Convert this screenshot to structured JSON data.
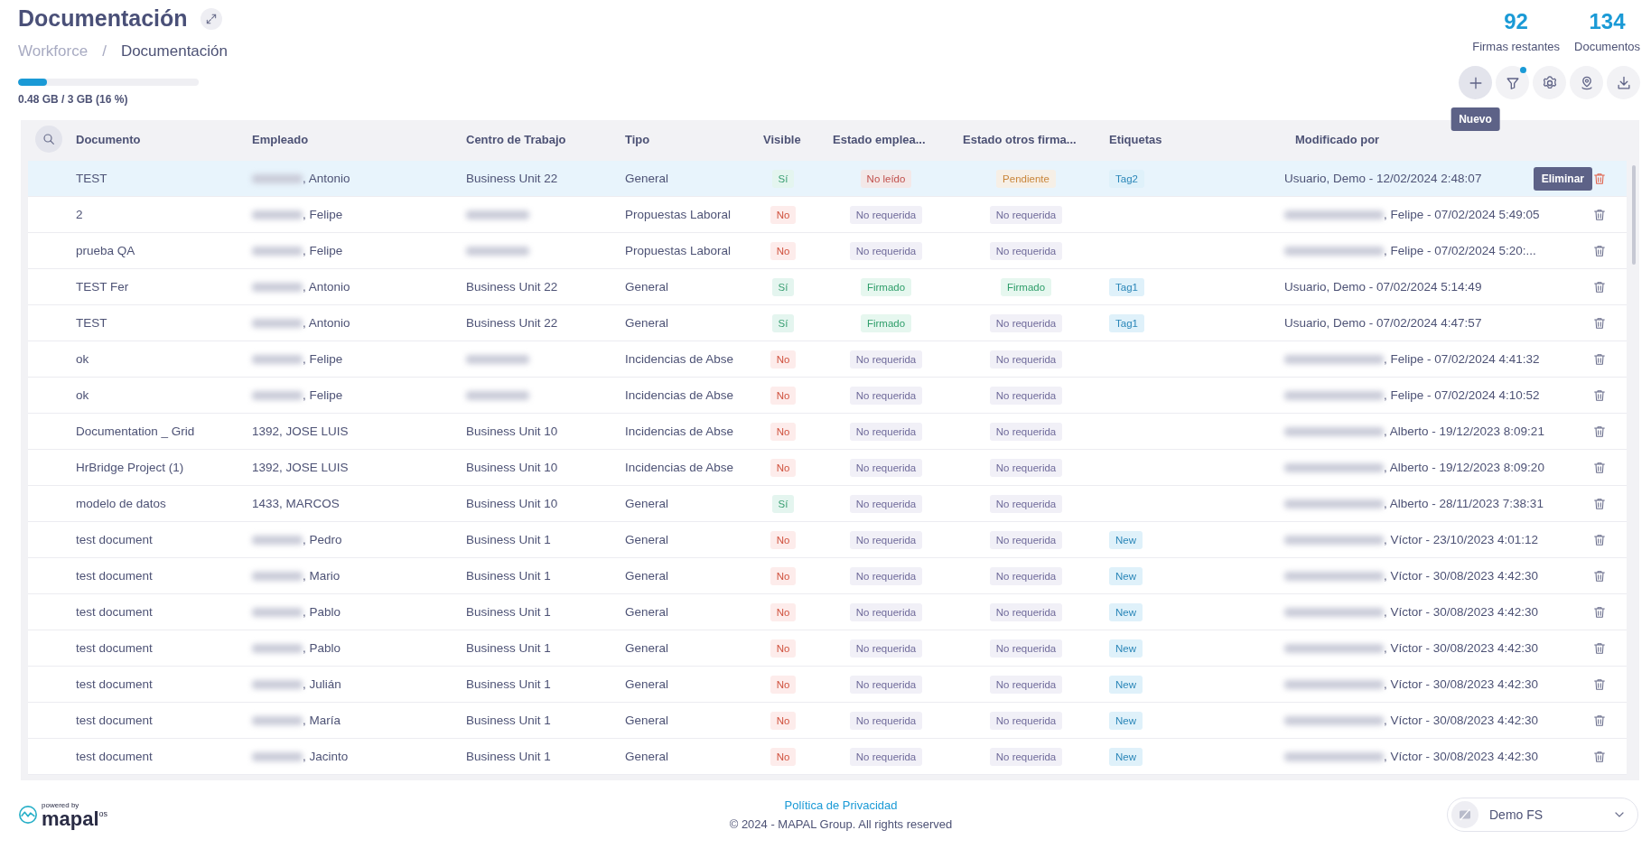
{
  "header": {
    "title": "Documentación",
    "breadcrumb_separator": "/",
    "breadcrumb": [
      {
        "label": "Workforce",
        "current": false
      },
      {
        "label": "Documentación",
        "current": true
      }
    ],
    "storage": {
      "level": 0.16,
      "label": "0.48 GB / 3 GB (16 %)"
    },
    "stats": [
      {
        "value": "92",
        "label": "Firmas restantes"
      },
      {
        "value": "134",
        "label": "Documentos"
      }
    ],
    "toolbar": [
      {
        "kind": "add",
        "active": true,
        "badge": false,
        "tooltip": "Nuevo"
      },
      {
        "kind": "filter",
        "active": false,
        "badge": true
      },
      {
        "kind": "settings",
        "active": false,
        "badge": false
      },
      {
        "kind": "location",
        "active": false,
        "badge": false
      },
      {
        "kind": "download",
        "active": false,
        "badge": false
      }
    ]
  },
  "table": {
    "columns": [
      "Documento",
      "Empleado",
      "Centro de Trabajo",
      "Tipo",
      "Visible",
      "Estado emplea...",
      "Estado otros firma...",
      "Etiquetas",
      "Modificado por"
    ],
    "rows": [
      {
        "document": "TEST",
        "employee": {
          "text": ", Antonio",
          "redacted": true
        },
        "center": {
          "text": "Business Unit 22",
          "redacted": false
        },
        "type": "General",
        "visible": {
          "label": "Sí",
          "on": true
        },
        "employee_status": {
          "label": "No leído",
          "kind": "unread"
        },
        "others_status": {
          "label": "Pendiente",
          "kind": "pending"
        },
        "tags": [
          "Tag2"
        ],
        "modified": {
          "text": "Usuario, Demo - 12/02/2024 2:48:07",
          "redacted": false
        },
        "hovered": true,
        "delete_tooltip": "Eliminar"
      },
      {
        "document": "2",
        "employee": {
          "text": ", Felipe",
          "redacted": true
        },
        "center": {
          "redacted": true
        },
        "type": "Propuestas Laboral",
        "visible": {
          "label": "No",
          "on": false
        },
        "employee_status": {
          "label": "No requerida",
          "kind": "not_required"
        },
        "others_status": {
          "label": "No requerida",
          "kind": "not_required"
        },
        "tags": [],
        "modified": {
          "text": ", Felipe - 07/02/2024 5:49:05",
          "redacted": true
        },
        "hovered": false
      },
      {
        "document": "prueba QA",
        "employee": {
          "text": ", Felipe",
          "redacted": true
        },
        "center": {
          "redacted": true
        },
        "type": "Propuestas Laboral",
        "visible": {
          "label": "No",
          "on": false
        },
        "employee_status": {
          "label": "No requerida",
          "kind": "not_required"
        },
        "others_status": {
          "label": "No requerida",
          "kind": "not_required"
        },
        "tags": [],
        "modified": {
          "text": ", Felipe - 07/02/2024 5:20:...",
          "redacted": true
        },
        "hovered": false
      },
      {
        "document": "TEST Fer",
        "employee": {
          "text": ", Antonio",
          "redacted": true
        },
        "center": {
          "text": "Business Unit 22",
          "redacted": false
        },
        "type": "General",
        "visible": {
          "label": "Sí",
          "on": true
        },
        "employee_status": {
          "label": "Firmado",
          "kind": "signed"
        },
        "others_status": {
          "label": "Firmado",
          "kind": "signed"
        },
        "tags": [
          "Tag1"
        ],
        "modified": {
          "text": "Usuario, Demo - 07/02/2024 5:14:49",
          "redacted": false
        },
        "hovered": false
      },
      {
        "document": "TEST",
        "employee": {
          "text": ", Antonio",
          "redacted": true
        },
        "center": {
          "text": "Business Unit 22",
          "redacted": false
        },
        "type": "General",
        "visible": {
          "label": "Sí",
          "on": true
        },
        "employee_status": {
          "label": "Firmado",
          "kind": "signed"
        },
        "others_status": {
          "label": "No requerida",
          "kind": "not_required"
        },
        "tags": [
          "Tag1"
        ],
        "modified": {
          "text": "Usuario, Demo - 07/02/2024 4:47:57",
          "redacted": false
        },
        "hovered": false
      },
      {
        "document": "ok",
        "employee": {
          "text": ", Felipe",
          "redacted": true
        },
        "center": {
          "redacted": true
        },
        "type": "Incidencias de Abse",
        "visible": {
          "label": "No",
          "on": false
        },
        "employee_status": {
          "label": "No requerida",
          "kind": "not_required"
        },
        "others_status": {
          "label": "No requerida",
          "kind": "not_required"
        },
        "tags": [],
        "modified": {
          "text": ", Felipe - 07/02/2024 4:41:32",
          "redacted": true
        },
        "hovered": false
      },
      {
        "document": "ok",
        "employee": {
          "text": ", Felipe",
          "redacted": true
        },
        "center": {
          "redacted": true
        },
        "type": "Incidencias de Abse",
        "visible": {
          "label": "No",
          "on": false
        },
        "employee_status": {
          "label": "No requerida",
          "kind": "not_required"
        },
        "others_status": {
          "label": "No requerida",
          "kind": "not_required"
        },
        "tags": [],
        "modified": {
          "text": ", Felipe - 07/02/2024 4:10:52",
          "redacted": true
        },
        "hovered": false
      },
      {
        "document": "Documentation _ Grid",
        "employee": {
          "text": "1392, JOSE LUIS",
          "redacted": false
        },
        "center": {
          "text": "Business Unit 10",
          "redacted": false
        },
        "type": "Incidencias de Abse",
        "visible": {
          "label": "No",
          "on": false
        },
        "employee_status": {
          "label": "No requerida",
          "kind": "not_required"
        },
        "others_status": {
          "label": "No requerida",
          "kind": "not_required"
        },
        "tags": [],
        "modified": {
          "text": ", Alberto - 19/12/2023 8:09:21",
          "redacted": true
        },
        "hovered": false
      },
      {
        "document": "HrBridge Project (1)",
        "employee": {
          "text": "1392, JOSE LUIS",
          "redacted": false
        },
        "center": {
          "text": "Business Unit 10",
          "redacted": false
        },
        "type": "Incidencias de Abse",
        "visible": {
          "label": "No",
          "on": false
        },
        "employee_status": {
          "label": "No requerida",
          "kind": "not_required"
        },
        "others_status": {
          "label": "No requerida",
          "kind": "not_required"
        },
        "tags": [],
        "modified": {
          "text": ", Alberto - 19/12/2023 8:09:20",
          "redacted": true
        },
        "hovered": false
      },
      {
        "document": "modelo de datos",
        "employee": {
          "text": "1433, MARCOS",
          "redacted": false
        },
        "center": {
          "text": "Business Unit 10",
          "redacted": false
        },
        "type": "General",
        "visible": {
          "label": "Sí",
          "on": true
        },
        "employee_status": {
          "label": "No requerida",
          "kind": "not_required"
        },
        "others_status": {
          "label": "No requerida",
          "kind": "not_required"
        },
        "tags": [],
        "modified": {
          "text": ", Alberto - 28/11/2023 7:38:31",
          "redacted": true
        },
        "hovered": false
      },
      {
        "document": "test document",
        "employee": {
          "text": ", Pedro",
          "redacted": true
        },
        "center": {
          "text": "Business Unit 1",
          "redacted": false
        },
        "type": "General",
        "visible": {
          "label": "No",
          "on": false
        },
        "employee_status": {
          "label": "No requerida",
          "kind": "not_required"
        },
        "others_status": {
          "label": "No requerida",
          "kind": "not_required"
        },
        "tags": [
          "New"
        ],
        "modified": {
          "text": ", Víctor - 23/10/2023 4:01:12",
          "redacted": true
        },
        "hovered": false
      },
      {
        "document": "test document",
        "employee": {
          "text": ", Mario",
          "redacted": true
        },
        "center": {
          "text": "Business Unit 1",
          "redacted": false
        },
        "type": "General",
        "visible": {
          "label": "No",
          "on": false
        },
        "employee_status": {
          "label": "No requerida",
          "kind": "not_required"
        },
        "others_status": {
          "label": "No requerida",
          "kind": "not_required"
        },
        "tags": [
          "New"
        ],
        "modified": {
          "text": ", Víctor - 30/08/2023 4:42:30",
          "redacted": true
        },
        "hovered": false
      },
      {
        "document": "test document",
        "employee": {
          "text": ", Pablo",
          "redacted": true
        },
        "center": {
          "text": "Business Unit 1",
          "redacted": false
        },
        "type": "General",
        "visible": {
          "label": "No",
          "on": false
        },
        "employee_status": {
          "label": "No requerida",
          "kind": "not_required"
        },
        "others_status": {
          "label": "No requerida",
          "kind": "not_required"
        },
        "tags": [
          "New"
        ],
        "modified": {
          "text": ", Víctor - 30/08/2023 4:42:30",
          "redacted": true
        },
        "hovered": false
      },
      {
        "document": "test document",
        "employee": {
          "text": ", Pablo",
          "redacted": true
        },
        "center": {
          "text": "Business Unit 1",
          "redacted": false
        },
        "type": "General",
        "visible": {
          "label": "No",
          "on": false
        },
        "employee_status": {
          "label": "No requerida",
          "kind": "not_required"
        },
        "others_status": {
          "label": "No requerida",
          "kind": "not_required"
        },
        "tags": [
          "New"
        ],
        "modified": {
          "text": ", Víctor - 30/08/2023 4:42:30",
          "redacted": true
        },
        "hovered": false
      },
      {
        "document": "test document",
        "employee": {
          "text": ", Julián",
          "redacted": true
        },
        "center": {
          "text": "Business Unit 1",
          "redacted": false
        },
        "type": "General",
        "visible": {
          "label": "No",
          "on": false
        },
        "employee_status": {
          "label": "No requerida",
          "kind": "not_required"
        },
        "others_status": {
          "label": "No requerida",
          "kind": "not_required"
        },
        "tags": [
          "New"
        ],
        "modified": {
          "text": ", Víctor - 30/08/2023 4:42:30",
          "redacted": true
        },
        "hovered": false
      },
      {
        "document": "test document",
        "employee": {
          "text": ", María",
          "redacted": true
        },
        "center": {
          "text": "Business Unit 1",
          "redacted": false
        },
        "type": "General",
        "visible": {
          "label": "No",
          "on": false
        },
        "employee_status": {
          "label": "No requerida",
          "kind": "not_required"
        },
        "others_status": {
          "label": "No requerida",
          "kind": "not_required"
        },
        "tags": [
          "New"
        ],
        "modified": {
          "text": ", Víctor - 30/08/2023 4:42:30",
          "redacted": true
        },
        "hovered": false
      },
      {
        "document": "test document",
        "employee": {
          "text": ", Jacinto",
          "redacted": true
        },
        "center": {
          "text": "Business Unit 1",
          "redacted": false
        },
        "type": "General",
        "visible": {
          "label": "No",
          "on": false
        },
        "employee_status": {
          "label": "No requerida",
          "kind": "not_required"
        },
        "others_status": {
          "label": "No requerida",
          "kind": "not_required"
        },
        "tags": [
          "New"
        ],
        "modified": {
          "text": ", Víctor - 30/08/2023 4:42:30",
          "redacted": true
        },
        "hovered": false
      }
    ]
  },
  "footer": {
    "logo": {
      "tagline": "powered by",
      "brand": "mapal",
      "suffix": "os"
    },
    "link": "Política de Privacidad",
    "copyright": "© 2024 - MAPAL Group. All rights reserved",
    "account": "Demo FS"
  }
}
